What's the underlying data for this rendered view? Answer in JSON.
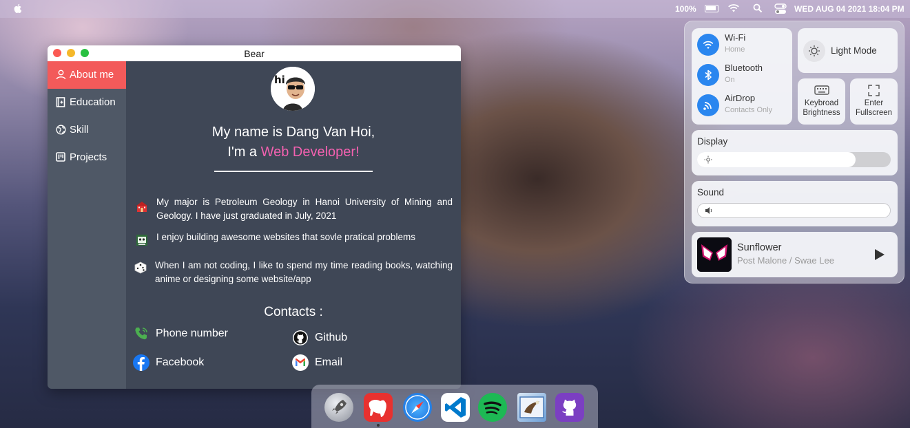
{
  "menubar": {
    "battery_pct": "100%",
    "clock": "WED AUG 04 2021 18:04 PM"
  },
  "window": {
    "title": "Bear",
    "sidebar": [
      {
        "label": "About me",
        "icon": "user-icon"
      },
      {
        "label": "Education",
        "icon": "book-icon"
      },
      {
        "label": "Skill",
        "icon": "globe-icon"
      },
      {
        "label": "Projects",
        "icon": "board-icon"
      }
    ],
    "hero": {
      "line1": "My name is Dang Van Hoi,",
      "line2_prefix": "I'm a ",
      "line2_role": "Web Developer!",
      "avatar_text": "hi"
    },
    "bio": [
      {
        "text": "My major is Petroleum Geology in Hanoi University of Mining and Geology. I have just graduated in July, 2021",
        "icon": "school-icon"
      },
      {
        "text": "I enjoy building awesome websites that sovle pratical problems",
        "icon": "computer-icon"
      },
      {
        "text": "When I am not coding, I like to spend my time reading books, watching anime or designing some website/app",
        "icon": "dice-icon"
      }
    ],
    "contacts_title": "Contacts :",
    "contacts": [
      {
        "label": "Phone number",
        "icon": "phone-icon"
      },
      {
        "label": "Github",
        "icon": "github-icon"
      },
      {
        "label": "Facebook",
        "icon": "facebook-icon"
      },
      {
        "label": "Email",
        "icon": "gmail-icon"
      }
    ]
  },
  "control_center": {
    "wifi": {
      "title": "Wi-Fi",
      "status": "Home"
    },
    "bluetooth": {
      "title": "Bluetooth",
      "status": "On"
    },
    "airdrop": {
      "title": "AirDrop",
      "status": "Contacts Only"
    },
    "light_mode": "Light Mode",
    "keyboard_brightness": [
      "Keybroad",
      "Brightness"
    ],
    "fullscreen": [
      "Enter",
      "Fullscreen"
    ],
    "display": {
      "title": "Display",
      "level": 0.82
    },
    "sound": {
      "title": "Sound",
      "level": 0.0
    },
    "music": {
      "title": "Sunflower",
      "artist": "Post Malone / Swae Lee"
    }
  },
  "dock": {
    "apps": [
      "launchpad-icon",
      "bear-icon",
      "safari-icon",
      "vscode-icon",
      "spotify-icon",
      "mail-icon",
      "github-icon"
    ],
    "colors": {
      "bear": "#e8312f",
      "spotify": "#1db954",
      "vscode": "#007acc",
      "github": "#7b3fc2"
    }
  },
  "colors": {
    "accent_red": "#f35a5a",
    "role_pink": "#f361b0",
    "sidebar_bg": "#4f5866",
    "content_bg": "#3f4756"
  }
}
